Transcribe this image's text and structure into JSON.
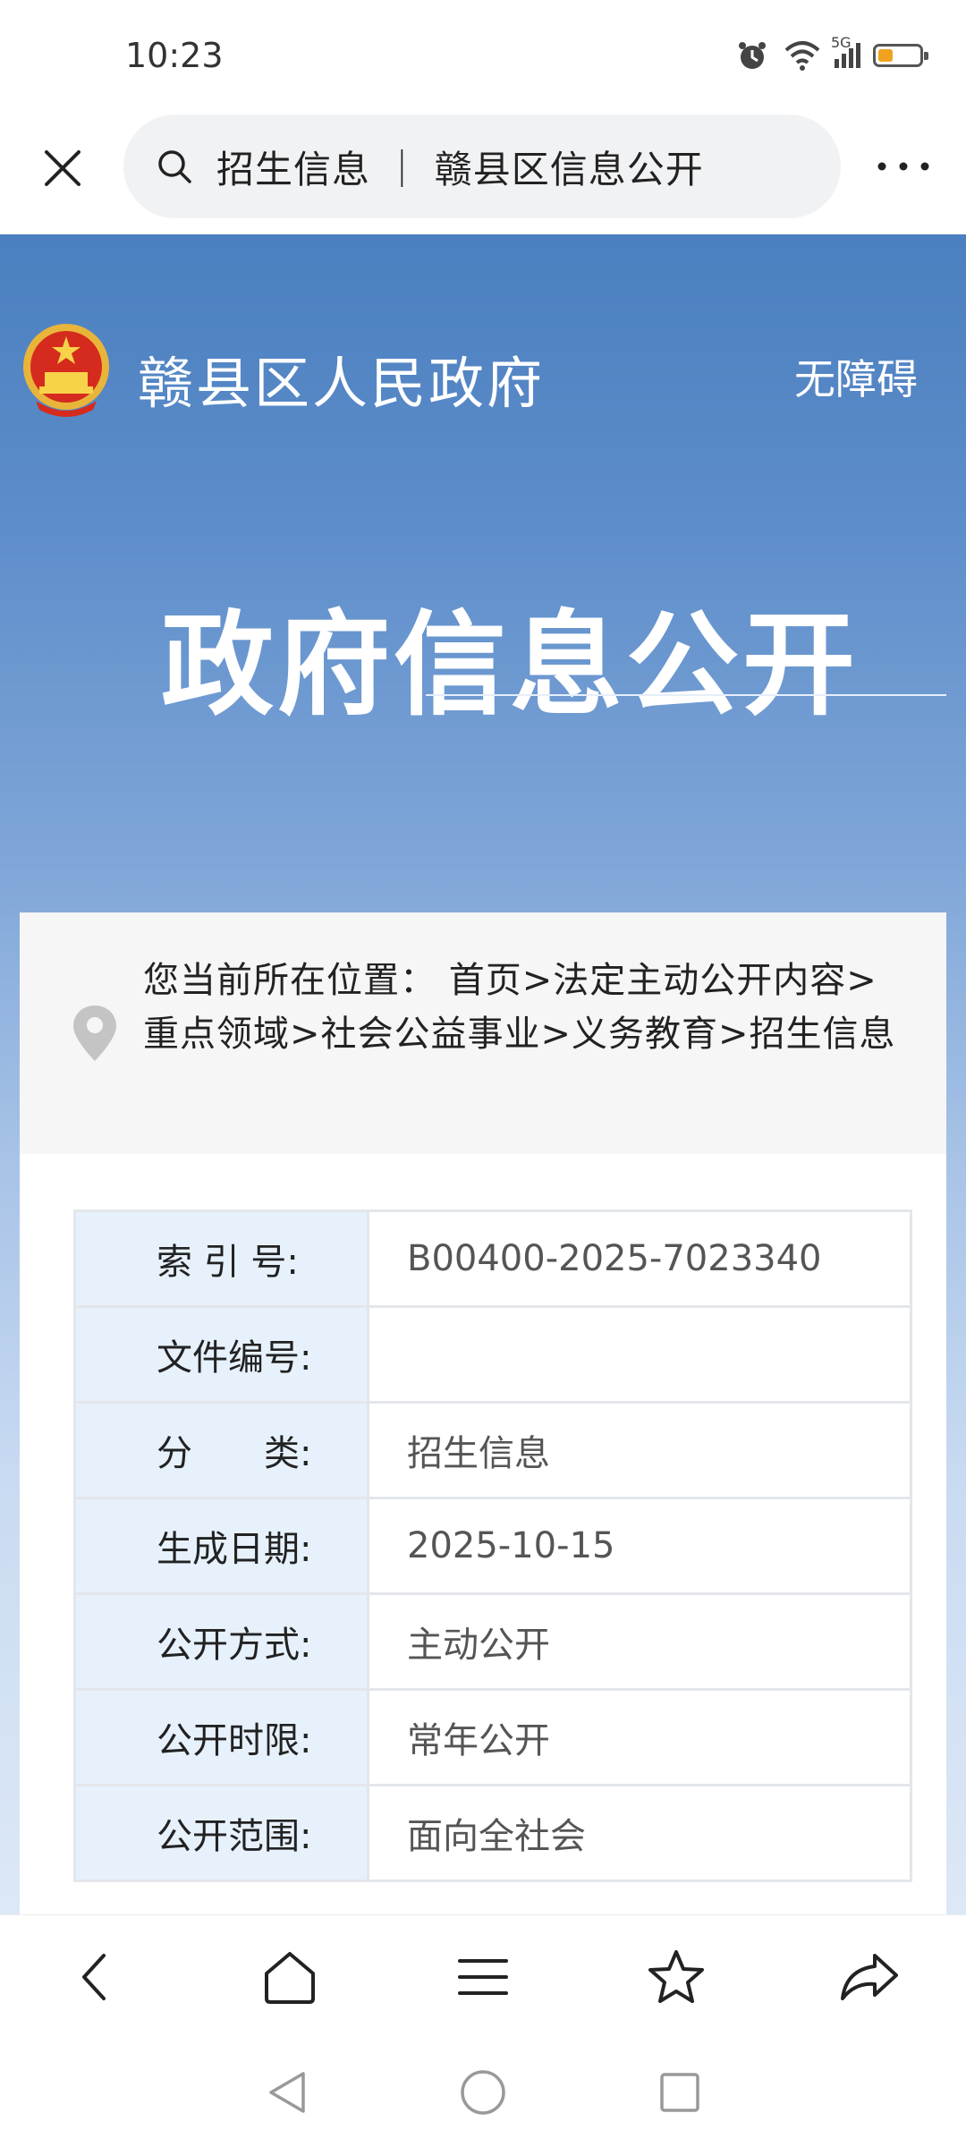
{
  "status": {
    "time": "10:23",
    "network": "5G"
  },
  "toolbar": {
    "address_text": "招生信息 ｜ 赣县区信息公开"
  },
  "site": {
    "name": "赣县区人民政府",
    "accessibility": "无障碍"
  },
  "hero": {
    "title": "政府信息公开"
  },
  "breadcrumb": {
    "text": "您当前所在位置： 首页>法定主动公开内容>重点领域>社会公益事业>义务教育>招生信息"
  },
  "meta": {
    "rows": [
      {
        "label": "索 引 号:",
        "value": "B00400-2025-7023340"
      },
      {
        "label": "文件编号:",
        "value": ""
      },
      {
        "label": "分　　类:",
        "value": "招生信息"
      },
      {
        "label": "生成日期:",
        "value": "2025-10-15"
      },
      {
        "label": "公开方式:",
        "value": "主动公开"
      },
      {
        "label": "公开时限:",
        "value": "常年公开"
      },
      {
        "label": "公开范围:",
        "value": "面向全社会"
      }
    ]
  },
  "colors": {
    "accent": "#4b7fbf",
    "battery": "#f0a21f",
    "key_cell": "#e7f1fc"
  },
  "icons": [
    "close-icon",
    "search-icon",
    "more-icon",
    "emblem-icon",
    "location-pin-icon",
    "back-icon",
    "home-icon",
    "menu-icon",
    "star-icon",
    "share-icon"
  ]
}
